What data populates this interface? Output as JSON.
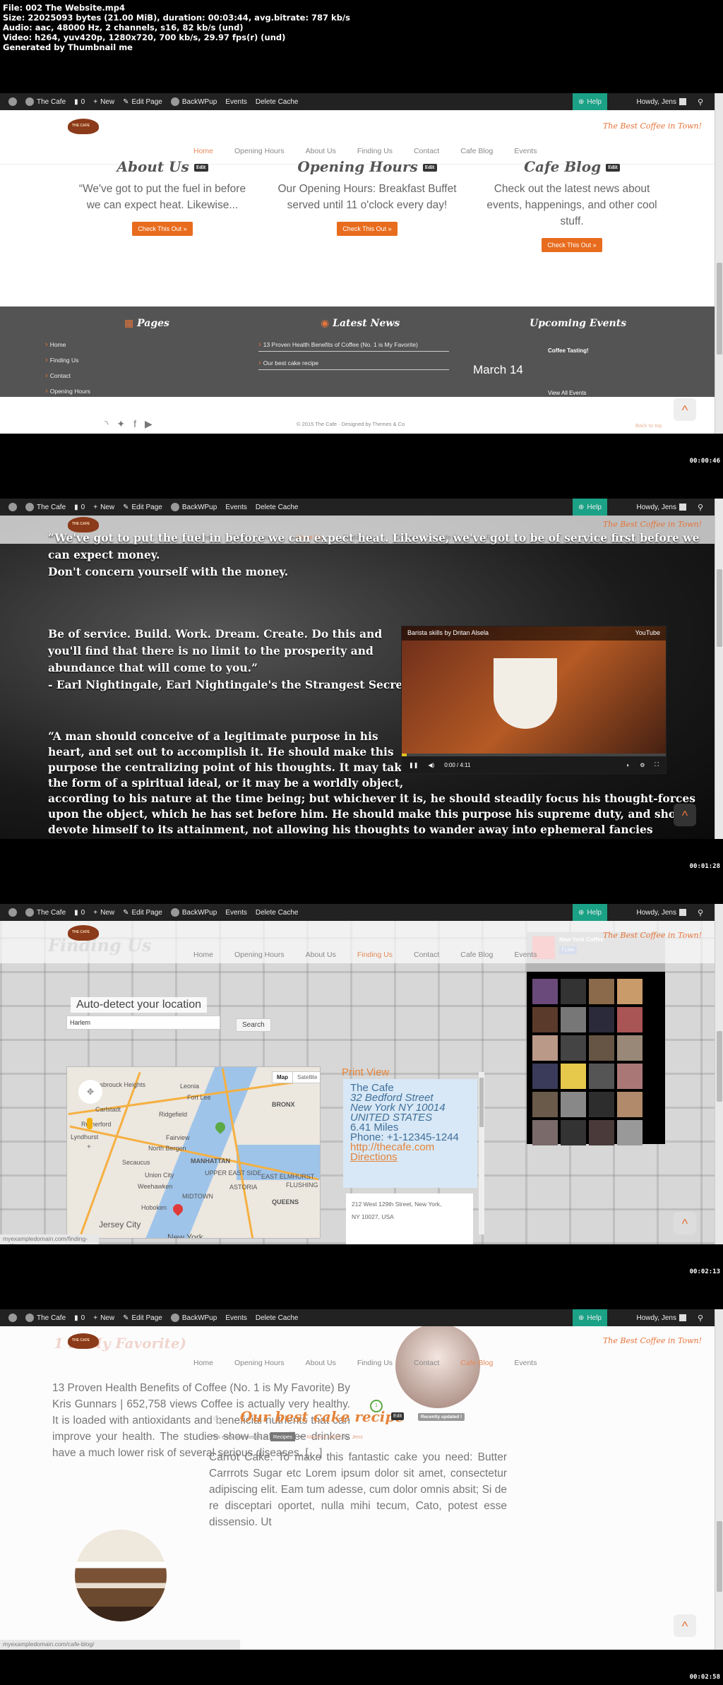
{
  "header": {
    "file": "File: 002 The Website.mp4",
    "size": "Size: 22025093 bytes (21.00 MiB), duration: 00:03:44, avg.bitrate: 787 kb/s",
    "audio": "Audio: aac, 48000 Hz, 2 channels, s16, 82 kb/s (und)",
    "video": "Video: h264, yuv420p, 1280x720, 700 kb/s, 29.97 fps(r) (und)",
    "generated": "Generated by Thumbnail me"
  },
  "adminbar": {
    "site": "The Cafe",
    "comments": "0",
    "new": "New",
    "edit_page": "Edit Page",
    "backwpup": "BackWPup",
    "events": "Events",
    "delete_cache": "Delete Cache",
    "help": "Help",
    "howdy": "Howdy, Jens"
  },
  "site": {
    "tagline": "The Best Coffee in Town!",
    "nav": [
      "Home",
      "Opening Hours",
      "About Us",
      "Finding Us",
      "Contact",
      "Cafe Blog",
      "Events"
    ]
  },
  "frame1": {
    "timestamp": "00:00:46",
    "active_nav": "Home",
    "columns": [
      {
        "title": "About Us",
        "edit": "Edit",
        "text": "“We've got to put the fuel in before we can expect heat. Likewise...",
        "button": "Check This Out »"
      },
      {
        "title": "Opening Hours",
        "edit": "Edit",
        "text": "Our Opening Hours: Breakfast Buffet served until 11 o'clock every day!",
        "button": "Check This Out »"
      },
      {
        "title": "Cafe Blog",
        "edit": "Edit",
        "text": "Check out the latest news about events, happenings, and other cool stuff.",
        "button": "Check This Out »"
      }
    ],
    "footer": {
      "pages_title": "Pages",
      "pages": [
        "Home",
        "Finding Us",
        "Contact",
        "Opening Hours"
      ],
      "news_title": "Latest News",
      "news": [
        "13 Proven Health Benefits of Coffee (No. 1 is My Favorite)",
        "Our best cake recipe"
      ],
      "events_title": "Upcoming Events",
      "event_name": "Coffee Tasting!",
      "event_date": "March 14",
      "view_all": "View All Events",
      "copyright": "© 2015 The Cafe · Designed by Themes & Co",
      "back_to_top": "Back to top"
    }
  },
  "frame2": {
    "timestamp": "00:01:28",
    "active_nav": "About Us",
    "quote1_lines": [
      "“We've got to put the fuel in before we can expect heat. Likewise, we've got to be of service first before we",
      "can expect money.",
      "Don't concern yourself with the money."
    ],
    "quote2_lines": [
      "Be of service. Build. Work. Dream. Create. Do this and",
      "you'll find that there is no limit to the prosperity and",
      "abundance that will come to you.”",
      "- Earl Nightingale, Earl Nightingale's the Strangest Secret"
    ],
    "quote3_lines": [
      "“A man should conceive of a legitimate purpose in his",
      "heart, and set out to accomplish it. He should make this",
      "purpose the centralizing point of his thoughts. It may take",
      "the form of a spiritual ideal, or it may be a worldly object,",
      "according to his nature at the time being; but whichever it is, he should steadily focus his thought-forces",
      "upon the object, which he has set before him. He should make this purpose his supreme duty, and should",
      "devote himself to its attainment, not allowing his thoughts to wander away into ephemeral fancies"
    ],
    "video": {
      "title": "Barista skills by Dritan Alsela",
      "brand": "YouTube",
      "time": "0:00 / 4:11",
      "progress": 0.02
    }
  },
  "frame3": {
    "timestamp": "00:02:13",
    "active_nav": "Finding Us",
    "page_title": "Finding Us",
    "autodetect": "Auto-detect your location",
    "search_value": "Harlem",
    "search_button": "Search",
    "map_type": [
      "Map",
      "Satellite"
    ],
    "map_labels": [
      "Hasbrouck Heights",
      "Leonia",
      "Fort Lee",
      "Carlstadt",
      "Ridgefield",
      "BRONX",
      "Rutherford",
      "Lyndhurst",
      "Fairview",
      "North Bergen",
      "MANHATTAN",
      "Secaucus",
      "Union City",
      "Weehawken",
      "ASTORIA",
      "QUEENS",
      "Hoboken",
      "Jersey City",
      "New York",
      "EAST ELMHURST",
      "FLUSHING",
      "MIDTOWN",
      "UPPER EAST SIDE"
    ],
    "print_view": "Print View",
    "info": {
      "name": "The Cafe",
      "street": "32 Bedford Street",
      "city": "New York NY 10014",
      "country": "UNITED STATES",
      "distance": "6.41 Miles",
      "phone": "Phone: +1-12345-1244",
      "url": "http://thecafe.com",
      "directions": "Directions"
    },
    "address_line1": "212 West 129th Street, New York,",
    "address_line2": "NY 10027, USA",
    "fb_page": "New York Coffee",
    "fb_like": "Like",
    "status_url": "myexampledomain.com/finding-us/#"
  },
  "frame4": {
    "timestamp": "00:02:58",
    "active_nav": "Cafe Blog",
    "post1_title_partial": "1 is My Favorite)",
    "post1_text": "13 Proven Health Benefits of Coffee (No. 1 is My Favorite) By Kris Gunnars | 652,758 views Coffee is actually very healthy. It is loaded with antioxidants and beneficial nutrients that can improve your health. The studies show that coffee drinkers have a much lower risk of several serious diseases. […]",
    "post2": {
      "title": "Our best cake recipe",
      "comment_count": "1",
      "edit": "Edit",
      "badge": "Recently updated !",
      "meta_prefix": "This entry was posted in",
      "category": "Recipes",
      "meta_on": "on",
      "date": "March 2, 2015",
      "meta_by": "by",
      "author": "Jens",
      "text": "Carrot Cake. To make this fantastic cake you need: Butter Carrrots Sugar etc Lorem ipsum dolor sit amet, consectetur adipiscing elit. Eam tum adesse, cum dolor omnis absit; Si de re disceptari oportet, nulla mihi tecum, Cato, potest esse dissensio. Ut"
    },
    "status_url": "myexampledomain.com/cafe-blog/"
  }
}
